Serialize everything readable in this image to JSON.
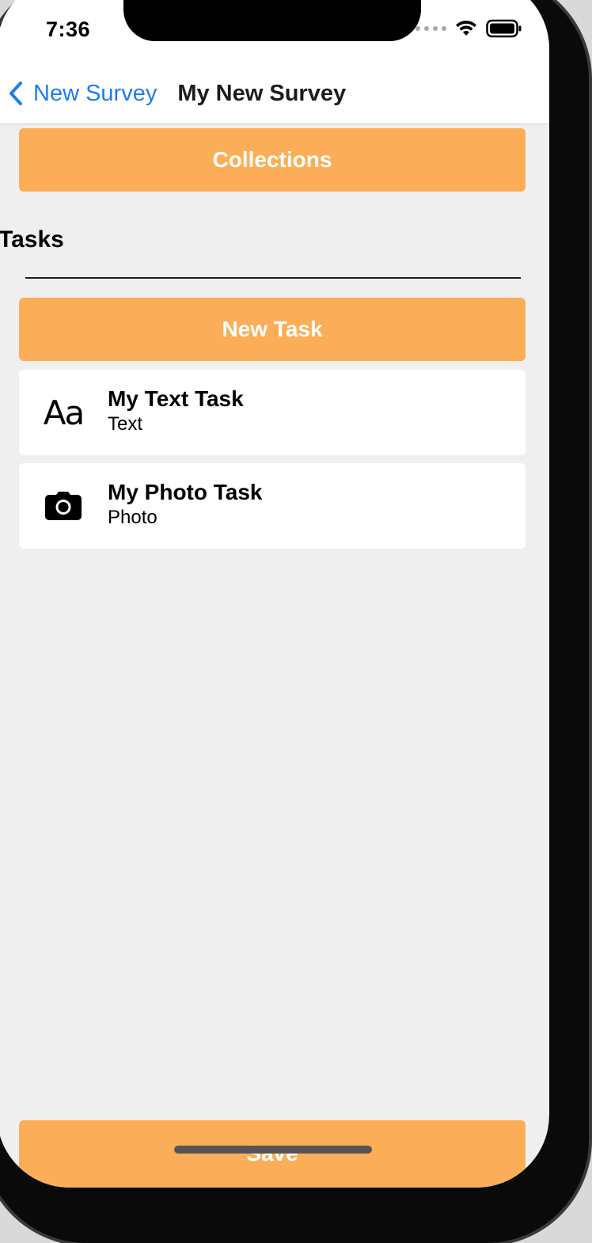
{
  "status_bar": {
    "time": "7:36",
    "signal_icon": "signal-dots-icon",
    "wifi_icon": "wifi-icon",
    "battery_icon": "battery-icon"
  },
  "nav": {
    "back_label": "New Survey",
    "title": "My New Survey",
    "back_icon": "chevron-left-icon"
  },
  "buttons": {
    "collections": "Collections",
    "new_task": "New Task",
    "save": "Save"
  },
  "tasks_section": {
    "title": "Tasks",
    "items": [
      {
        "name": "My Text Task",
        "type": "Text",
        "icon": "text-format-icon"
      },
      {
        "name": "My Photo Task",
        "type": "Photo",
        "icon": "camera-icon"
      }
    ]
  },
  "colors": {
    "accent": "#fbae57",
    "link": "#1e7cf2",
    "background": "#efefef"
  }
}
